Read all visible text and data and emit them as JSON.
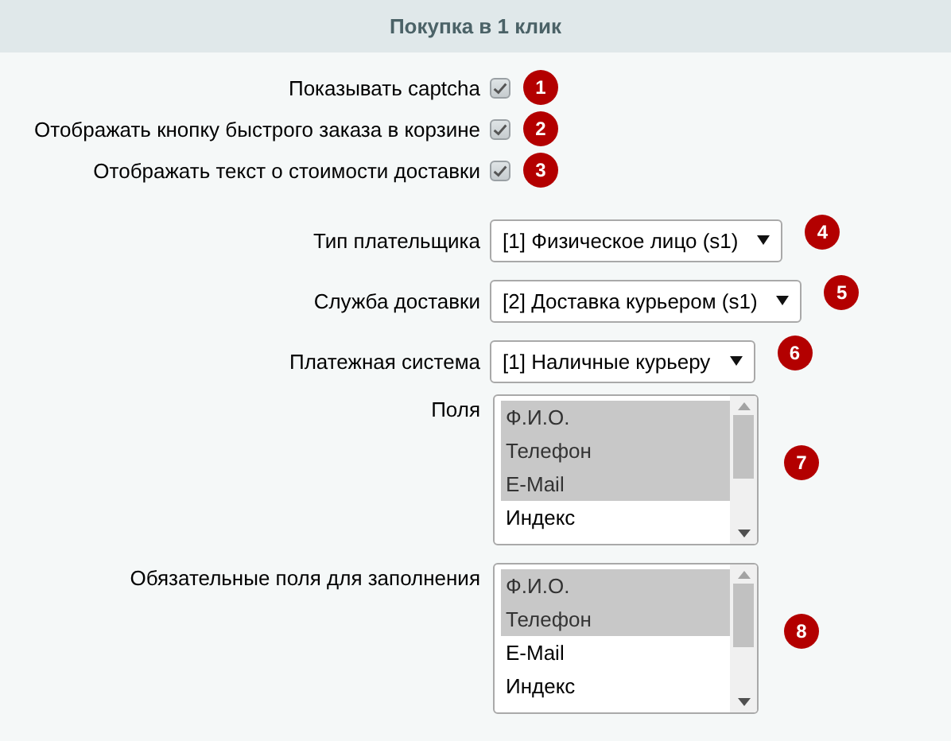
{
  "title": "Покупка в 1 клик",
  "rows": [
    {
      "kind": "checkbox",
      "label": "Показывать captcha",
      "checked": true,
      "badge": "1"
    },
    {
      "kind": "checkbox",
      "label": "Отображать кнопку быстрого заказа в корзине",
      "checked": true,
      "badge": "2"
    },
    {
      "kind": "checkbox",
      "label": "Отображать текст о стоимости доставки",
      "checked": true,
      "badge": "3"
    },
    {
      "kind": "select",
      "label": "Тип плательщика",
      "value": "[1] Физическое лицо (s1)",
      "badge": "4"
    },
    {
      "kind": "select",
      "label": "Служба доставки",
      "value": "[2] Доставка курьером (s1)",
      "badge": "5"
    },
    {
      "kind": "select",
      "label": "Платежная система",
      "value": "[1] Наличные курьеру",
      "badge": "6"
    },
    {
      "kind": "list",
      "label": "Поля",
      "badge": "7",
      "options": [
        {
          "text": "Ф.И.О.",
          "selected": true
        },
        {
          "text": "Телефон",
          "selected": true
        },
        {
          "text": "E-Mail",
          "selected": true
        },
        {
          "text": "Индекс",
          "selected": false
        }
      ]
    },
    {
      "kind": "list",
      "label": "Обязательные поля для заполнения",
      "badge": "8",
      "options": [
        {
          "text": "Ф.И.О.",
          "selected": true
        },
        {
          "text": "Телефон",
          "selected": true
        },
        {
          "text": "E-Mail",
          "selected": false
        },
        {
          "text": "Индекс",
          "selected": false
        }
      ]
    }
  ]
}
